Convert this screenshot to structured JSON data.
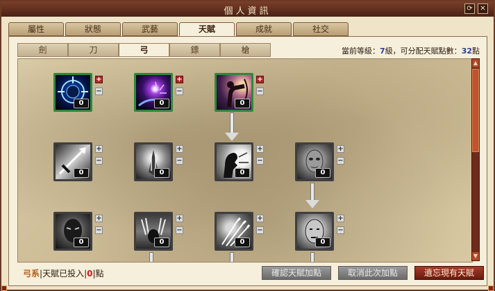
{
  "window": {
    "title": "個人資訊",
    "btn_refresh": "⟳",
    "btn_close": "✕"
  },
  "tabs": [
    "屬性",
    "狀態",
    "武藝",
    "天賦",
    "成就",
    "社交"
  ],
  "active_tab": 3,
  "subtabs": [
    "劍",
    "刀",
    "弓",
    "鏢",
    "槍"
  ],
  "active_subtab": 2,
  "info": {
    "prefix": "當前等級：",
    "level": "7",
    "mid": "級，可分配天賦點數：",
    "points": "32",
    "suffix": "點"
  },
  "skills": [
    {
      "level": "0",
      "learned": true,
      "icon": "target-head-icon"
    },
    {
      "level": "0",
      "learned": true,
      "icon": "purple-orb-hand-icon"
    },
    {
      "level": "0",
      "learned": true,
      "icon": "archer-aim-icon"
    },
    {
      "level": "0",
      "learned": false,
      "icon": "pierce-arrow-icon"
    },
    {
      "level": "0",
      "learned": false,
      "icon": "praying-hands-icon"
    },
    {
      "level": "0",
      "learned": false,
      "icon": "shout-profile-icon"
    },
    {
      "level": "0",
      "learned": false,
      "icon": "stone-face-icon"
    },
    {
      "level": "0",
      "learned": false,
      "icon": "dark-head-icon"
    },
    {
      "level": "0",
      "learned": false,
      "icon": "warrior-claws-icon"
    },
    {
      "level": "0",
      "learned": false,
      "icon": "multi-arrow-icon"
    },
    {
      "level": "0",
      "learned": false,
      "icon": "bald-face-icon"
    }
  ],
  "footer": {
    "branch": "弓系",
    "sep1": "|",
    "invested_label": "天賦已投入",
    "sep2": "|",
    "invested": "0",
    "sep3": "|",
    "unit": "點"
  },
  "buttons": {
    "confirm": "確認天賦加點",
    "cancel": "取消此次加點",
    "forget": "遺忘現有天賦"
  }
}
